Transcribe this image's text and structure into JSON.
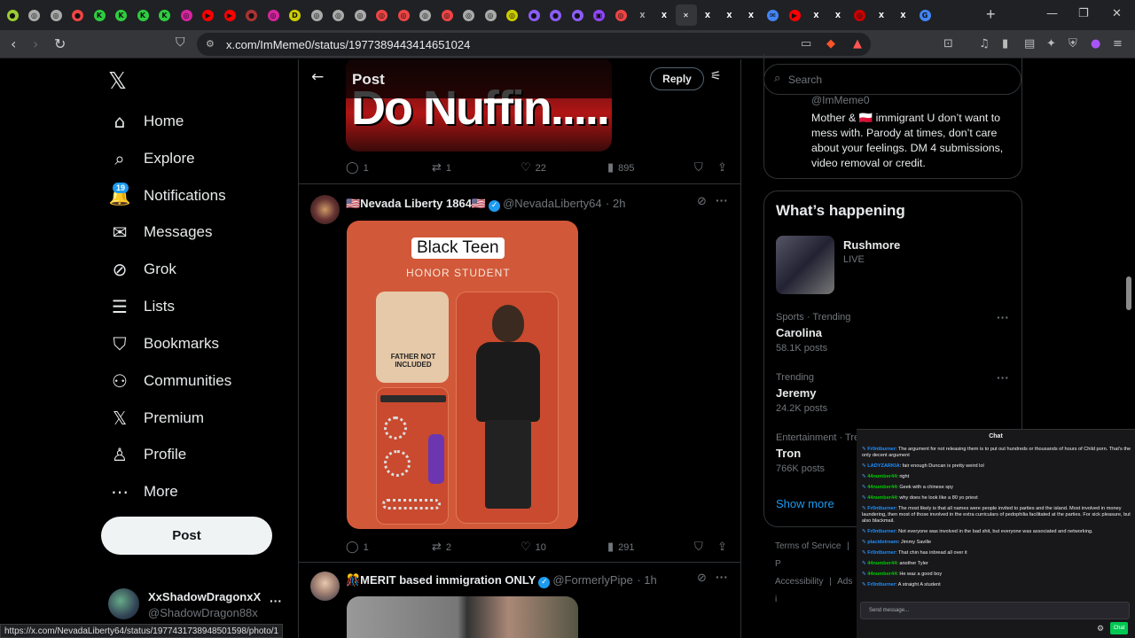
{
  "browser": {
    "url": "x.com/ImMeme0/status/1977389443414651024",
    "tabs": [
      {
        "color": "#9acd32",
        "glyph": "●"
      },
      {
        "color": "#aaa",
        "glyph": "◎"
      },
      {
        "color": "#aaa",
        "glyph": "◎"
      },
      {
        "color": "#e44",
        "glyph": "●"
      },
      {
        "color": "#2ecc40",
        "glyph": "K"
      },
      {
        "color": "#2ecc40",
        "glyph": "K"
      },
      {
        "color": "#2ecc40",
        "glyph": "K"
      },
      {
        "color": "#2ecc40",
        "glyph": "K"
      },
      {
        "color": "#d6249f",
        "glyph": "◎"
      },
      {
        "color": "#ff0000",
        "glyph": "▶"
      },
      {
        "color": "#ff0000",
        "glyph": "▶"
      },
      {
        "color": "#a33",
        "glyph": "●"
      },
      {
        "color": "#d6249f",
        "glyph": "◎"
      },
      {
        "color": "#cc0",
        "glyph": "D"
      },
      {
        "color": "#aaa",
        "glyph": "◎"
      },
      {
        "color": "#aaa",
        "glyph": "◎"
      },
      {
        "color": "#aaa",
        "glyph": "◎"
      },
      {
        "color": "#e44",
        "glyph": "◎"
      },
      {
        "color": "#e44",
        "glyph": "◎"
      },
      {
        "color": "#aaa",
        "glyph": "◎"
      },
      {
        "color": "#e44",
        "glyph": "◎"
      },
      {
        "color": "#aaa",
        "glyph": "◎"
      },
      {
        "color": "#aaa",
        "glyph": "◎"
      },
      {
        "color": "#cc0",
        "glyph": "◎"
      },
      {
        "color": "#8a5cf6",
        "glyph": "●"
      },
      {
        "color": "#8a5cf6",
        "glyph": "●"
      },
      {
        "color": "#8a5cf6",
        "glyph": "●"
      },
      {
        "color": "#9146ff",
        "glyph": "▣"
      },
      {
        "color": "#e44",
        "glyph": "◎"
      },
      {
        "color": "#aaa",
        "glyph": "X"
      },
      {
        "color": "#fff",
        "glyph": "X"
      },
      {
        "color": "#fff",
        "glyph": "✕"
      },
      {
        "color": "#fff",
        "glyph": "X"
      },
      {
        "color": "#fff",
        "glyph": "X"
      },
      {
        "color": "#fff",
        "glyph": "X"
      },
      {
        "color": "#4285f4",
        "glyph": "✉"
      },
      {
        "color": "#ff0000",
        "glyph": "▶"
      },
      {
        "color": "#fff",
        "glyph": "X"
      },
      {
        "color": "#fff",
        "glyph": "X"
      },
      {
        "color": "#c00",
        "glyph": "◎"
      },
      {
        "color": "#fff",
        "glyph": "X"
      },
      {
        "color": "#fff",
        "glyph": "X"
      },
      {
        "color": "#4285f4",
        "glyph": "G"
      }
    ],
    "status_link": "https://x.com/NevadaLiberty64/status/1977431738948501598/photo/1"
  },
  "sidebar": {
    "logo": "𝕏",
    "items": [
      {
        "label": "Home",
        "icon": "⌂"
      },
      {
        "label": "Explore",
        "icon": "⌕"
      },
      {
        "label": "Notifications",
        "icon": "🔔"
      },
      {
        "label": "Messages",
        "icon": "✉"
      },
      {
        "label": "Grok",
        "icon": "⊘"
      },
      {
        "label": "Lists",
        "icon": "☰"
      },
      {
        "label": "Bookmarks",
        "icon": "⛉"
      },
      {
        "label": "Communities",
        "icon": "⚇"
      },
      {
        "label": "Premium",
        "icon": "𝕏"
      },
      {
        "label": "Profile",
        "icon": "♙"
      },
      {
        "label": "More",
        "icon": "⋯"
      }
    ],
    "notif_badge": "19",
    "post_label": "Post",
    "account": {
      "name": "XxShadowDragonxX",
      "handle": "@ShadowDragon88x"
    }
  },
  "header": {
    "title": "Post",
    "reply_label": "Reply"
  },
  "tweets": [
    {
      "image_text": "Do Nuffin.....",
      "stats": {
        "replies": "1",
        "reposts": "1",
        "likes": "22",
        "views": "895"
      }
    },
    {
      "name": "🇺🇸Nevada Liberty 1864🇺🇸",
      "handle": "@NevadaLiberty64",
      "time": "· 2h",
      "box_title": "Black Teen",
      "box_subtitle": "HONOR STUDENT",
      "box_note": "FATHER NOT INCLUDED",
      "stats": {
        "replies": "1",
        "reposts": "2",
        "likes": "10",
        "views": "291"
      }
    },
    {
      "name": "🎊MERIT based immigration ONLY",
      "handle": "@FormerlyPipe",
      "time": "· 1h"
    }
  ],
  "search": {
    "placeholder": "Search"
  },
  "profile_card": {
    "handle": "@ImMeme0",
    "bio": "Mother & 🇵🇱 immigrant U don’t want to mess with. Parody at times, don’t care about your feelings. DM 4 submissions, video removal or credit."
  },
  "happening": {
    "title": "What’s happening",
    "live": {
      "name": "Rushmore",
      "status": "LIVE"
    },
    "trends": [
      {
        "category": "Sports · Trending",
        "name": "Carolina",
        "posts": "58.1K posts"
      },
      {
        "category": "Trending",
        "name": "Jeremy",
        "posts": "24.2K posts"
      },
      {
        "category": "Entertainment · Tre",
        "name": "Tron",
        "posts": "766K posts"
      }
    ],
    "show_more": "Show more"
  },
  "footer_links": [
    "Terms of Service",
    "|",
    "P",
    "Accessibility",
    "|",
    "Ads i"
  ],
  "chat": {
    "title": "Chat",
    "placeholder": "Send message...",
    "chat_button": "Chat",
    "messages": [
      {
        "user": "Fr0ntburner",
        "color": "#1e90ff",
        "text": "The argument for not releasing them is to put out hundreds or thousands of hours of Child porn. That's the only decent argument"
      },
      {
        "user": "LADYZARKIA",
        "color": "#1e90ff",
        "text": "fair enough Duncan is pretty weird lol"
      },
      {
        "user": "44number44",
        "color": "#00c800",
        "text": "right"
      },
      {
        "user": "44number44",
        "color": "#00c800",
        "text": "Geek with a chinese spy"
      },
      {
        "user": "44number44",
        "color": "#00c800",
        "text": "why does he look like a 80 yo priest"
      },
      {
        "user": "Fr0ntburner",
        "color": "#1e90ff",
        "text": "The most likely is that all names were people invited to parties and the island. Most involved in money laundering, then most of those involved in the extra curriculars of pedophilia facilitated at the parties. For sick pleasure, but also blackmail."
      },
      {
        "user": "Fr0ntburner",
        "color": "#1e90ff",
        "text": "Not everyone was involved in the bad shit, but everyone was associated and networking."
      },
      {
        "user": "placidstream",
        "color": "#1e90ff",
        "text": "Jimmy Saville"
      },
      {
        "user": "Fr0ntburner",
        "color": "#1e90ff",
        "text": "That chin has inbread all over it"
      },
      {
        "user": "44number44",
        "color": "#00c800",
        "text": "another Tyler"
      },
      {
        "user": "44number44",
        "color": "#00c800",
        "text": "He waz a good boy"
      },
      {
        "user": "Fr0ntburner",
        "color": "#1e90ff",
        "text": "A straight A student"
      }
    ]
  }
}
